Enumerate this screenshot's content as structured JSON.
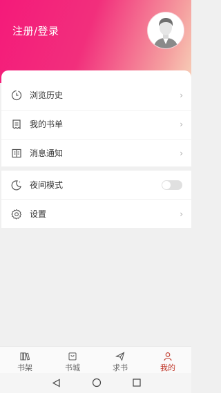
{
  "header": {
    "login_label": "注册/登录"
  },
  "menu": [
    {
      "label": "浏览历史",
      "icon": "clock-icon"
    },
    {
      "label": "我的书单",
      "icon": "receipt-icon"
    },
    {
      "label": "消息通知",
      "icon": "book-icon"
    }
  ],
  "settings": [
    {
      "label": "夜间模式",
      "icon": "moon-icon",
      "toggle": "off"
    },
    {
      "label": "设置",
      "icon": "gear-icon"
    }
  ],
  "chevron": "›",
  "tabs": [
    {
      "label": "书架",
      "icon": "bookshelf-icon",
      "active": false
    },
    {
      "label": "书城",
      "icon": "bag-icon",
      "active": false
    },
    {
      "label": "求书",
      "icon": "send-icon",
      "active": false
    },
    {
      "label": "我的",
      "icon": "person-icon",
      "active": true
    }
  ],
  "colors": {
    "accent": "#f41a7a",
    "tab_active": "#c0392b"
  }
}
